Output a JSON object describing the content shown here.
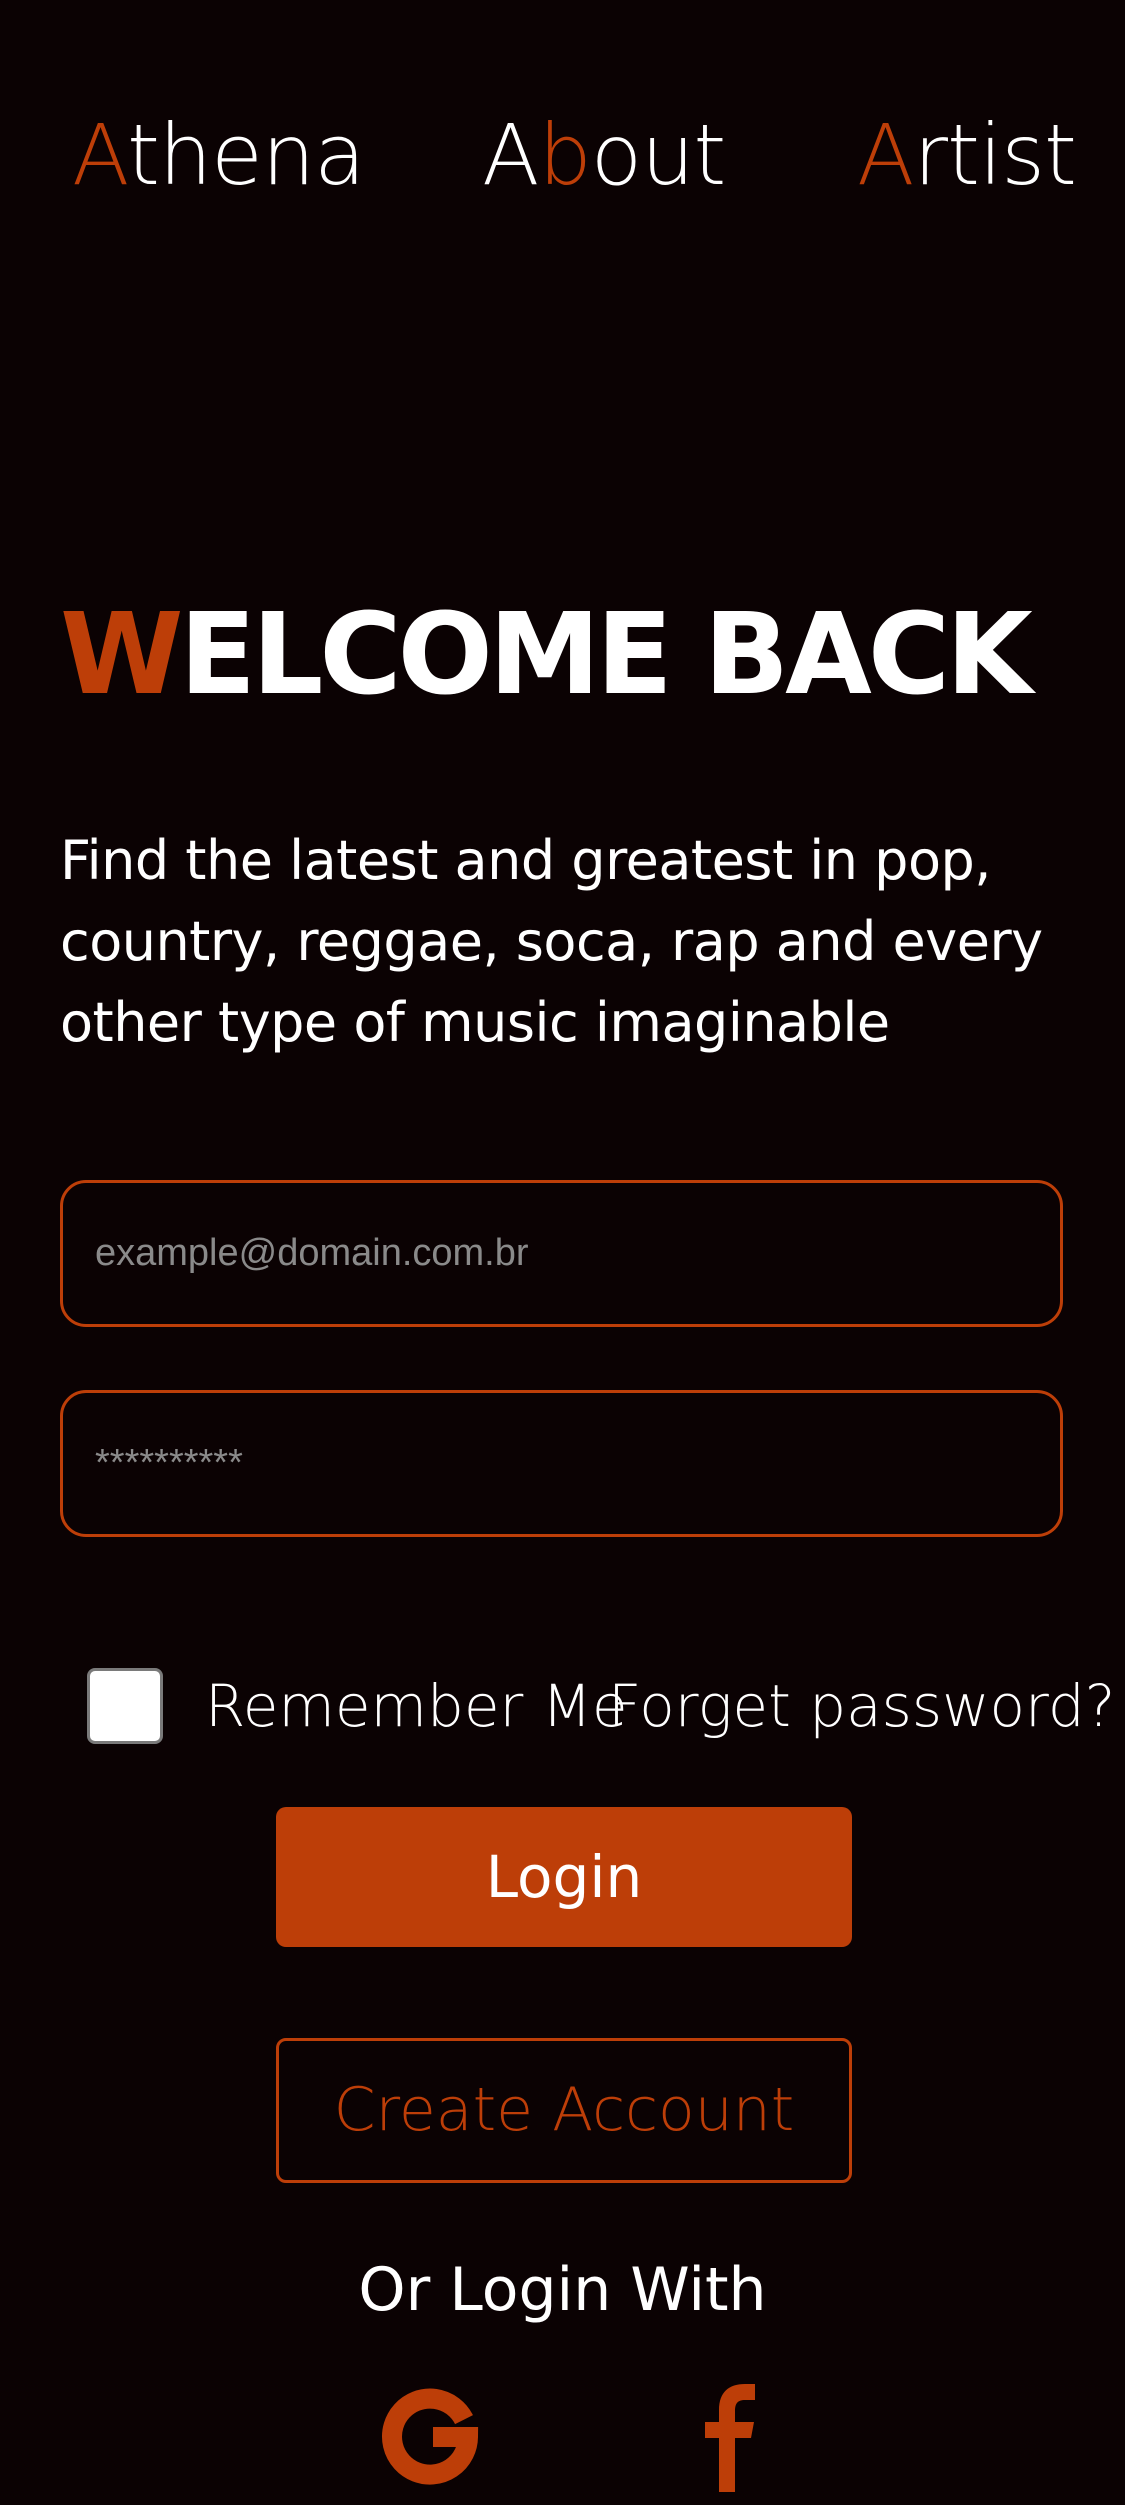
{
  "nav": {
    "athena": {
      "first": "A",
      "rest": "thena"
    },
    "about": {
      "first": "A",
      "accent": "b",
      "rest": "out"
    },
    "artist": {
      "first": "A",
      "rest": "rtist"
    }
  },
  "hero": {
    "title_first": "W",
    "title_rest": "ELCOME BACK",
    "subtitle": "Find the latest and greatest in pop, country, reggae, soca, rap and every other type of music imaginable"
  },
  "form": {
    "email_placeholder": "example@domain.com.br",
    "password_placeholder": "**********",
    "remember_label": "Remember Me",
    "forgot_label": "Forget password?",
    "login_label": "Login",
    "create_label": "Create Account"
  },
  "social": {
    "heading": "Or Login With",
    "providers": [
      {
        "icon": "google-icon"
      },
      {
        "icon": "facebook-icon"
      }
    ]
  },
  "colors": {
    "background": "#0b0203",
    "accent": "#bd3e08",
    "text": "#ffffff",
    "placeholder": "#8a8a8a"
  }
}
